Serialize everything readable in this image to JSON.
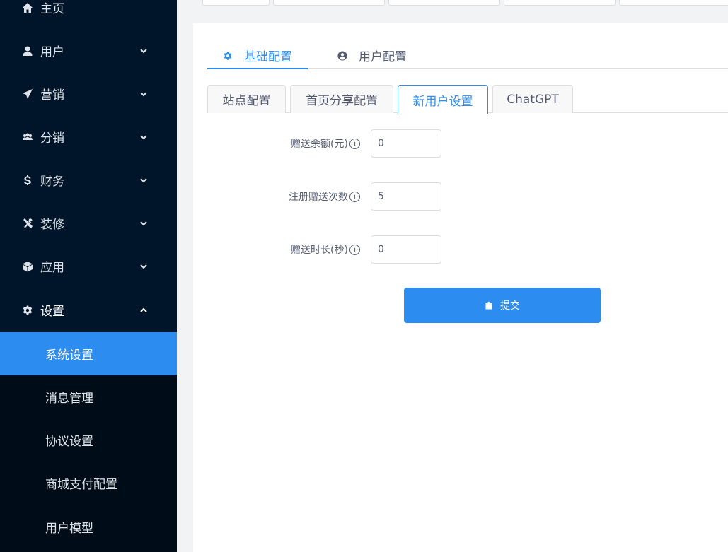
{
  "sidebar": {
    "items": [
      {
        "label": "主页",
        "icon": "home-icon"
      },
      {
        "label": "用户",
        "icon": "user-icon"
      },
      {
        "label": "营销",
        "icon": "send-icon"
      },
      {
        "label": "分销",
        "icon": "group-icon"
      },
      {
        "label": "财务",
        "icon": "dollar-icon"
      },
      {
        "label": "装修",
        "icon": "tools-icon"
      },
      {
        "label": "应用",
        "icon": "cube-icon"
      },
      {
        "label": "设置",
        "icon": "gear-icon"
      }
    ],
    "sub_items": [
      {
        "label": "系统设置"
      },
      {
        "label": "消息管理"
      },
      {
        "label": "协议设置"
      },
      {
        "label": "商城支付配置"
      },
      {
        "label": "用户模型"
      }
    ],
    "active_sub": "系统设置"
  },
  "top_tabs": [
    {
      "label": "基础配置",
      "icon": "gear-icon"
    },
    {
      "label": "用户配置",
      "icon": "user-circle-icon"
    }
  ],
  "card_tabs": [
    {
      "label": "站点配置"
    },
    {
      "label": "首页分享配置"
    },
    {
      "label": "新用户设置"
    },
    {
      "label": "ChatGPT"
    }
  ],
  "form": {
    "fields": [
      {
        "label": "赠送余额(元)",
        "value": "0"
      },
      {
        "label": "注册赠送次数",
        "value": "5"
      },
      {
        "label": "赠送时长(秒)",
        "value": "0"
      }
    ],
    "info_glyph": "i",
    "submit_label": "提交"
  },
  "colors": {
    "sidebar_bg": "#001529",
    "submenu_bg": "#000c17",
    "accent": "#2d8cf0",
    "text": "#515a6e"
  }
}
